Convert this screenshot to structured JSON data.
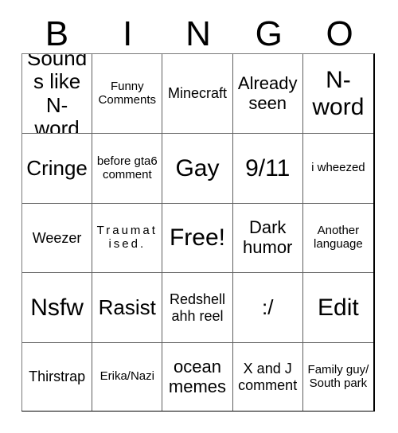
{
  "card": {
    "title_letters": [
      "B",
      "I",
      "N",
      "G",
      "O"
    ],
    "columns": 5,
    "rows": 5,
    "free_space_label": "Free!",
    "colors": {
      "background": "#ffffff",
      "text": "#000000",
      "grid_line": "#5f5f5f",
      "outer_border": "#000000"
    },
    "cells": [
      {
        "text": "Sounds like N-word",
        "size": "s-lg"
      },
      {
        "text": "Funny Comments",
        "size": "s-xs"
      },
      {
        "text": "Minecraft",
        "size": "s-sm"
      },
      {
        "text": "Already seen",
        "size": "s-md"
      },
      {
        "text": "N-word",
        "size": "s-xl"
      },
      {
        "text": "Cringe",
        "size": "s-lg"
      },
      {
        "text": "before gta6 comment",
        "size": "s-xs"
      },
      {
        "text": "Gay",
        "size": "s-xl"
      },
      {
        "text": "9/11",
        "size": "s-xl"
      },
      {
        "text": "i wheezed",
        "size": "s-xs"
      },
      {
        "text": "Weezer",
        "size": "s-sm"
      },
      {
        "text": "Traumatised.",
        "size": "s-xs",
        "tracking": true
      },
      {
        "text": "Free!",
        "size": "s-xl"
      },
      {
        "text": "Dark humor",
        "size": "s-md"
      },
      {
        "text": "Another language",
        "size": "s-xs"
      },
      {
        "text": "Nsfw",
        "size": "s-xl"
      },
      {
        "text": "Rasist",
        "size": "s-lg"
      },
      {
        "text": "Redshell ahh reel",
        "size": "s-sm"
      },
      {
        "text": ":/",
        "size": "s-lg"
      },
      {
        "text": "Edit",
        "size": "s-xl"
      },
      {
        "text": "Thirstrap",
        "size": "s-sm"
      },
      {
        "text": "Erika/Nazi",
        "size": "s-xs"
      },
      {
        "text": "ocean memes",
        "size": "s-md"
      },
      {
        "text": "X and J comment",
        "size": "s-sm"
      },
      {
        "text": "Family guy/ South park",
        "size": "s-xs"
      }
    ]
  }
}
